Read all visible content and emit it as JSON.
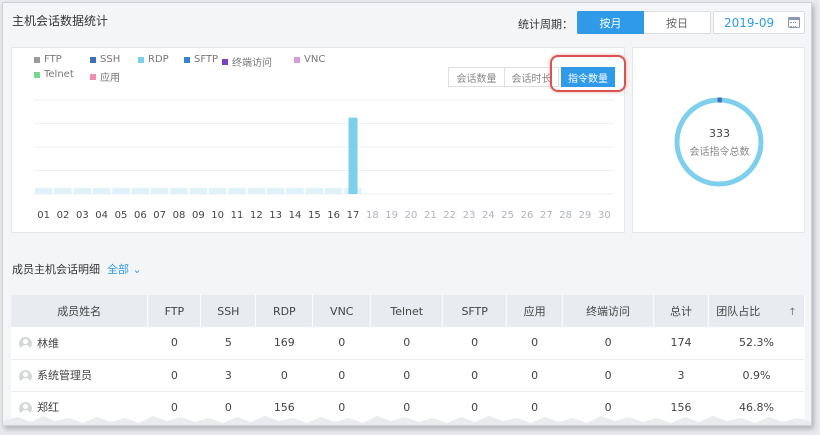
{
  "header": {
    "title": "主机会话数据统计",
    "period_label": "统计周期：",
    "by_month": "按月",
    "by_day": "按日",
    "date_value": "2019-09"
  },
  "legend": [
    {
      "label": "FTP",
      "color": "#9b9b9b"
    },
    {
      "label": "SSH",
      "color": "#3f6fb6"
    },
    {
      "label": "RDP",
      "color": "#7ecfee"
    },
    {
      "label": "SFTP",
      "color": "#3b82d6"
    },
    {
      "label": "终端访问",
      "color": "#7c3fc6"
    },
    {
      "label": "VNC",
      "color": "#d99be0"
    },
    {
      "label": "Telnet",
      "color": "#77d98a"
    },
    {
      "label": "应用",
      "color": "#f28db0"
    }
  ],
  "modes": {
    "count": "会话数量",
    "duration": "会话时长",
    "command": "指令数量"
  },
  "chart_data": {
    "type": "bar",
    "categories": [
      "01",
      "02",
      "03",
      "04",
      "05",
      "06",
      "07",
      "08",
      "09",
      "10",
      "11",
      "12",
      "13",
      "14",
      "15",
      "16",
      "17",
      "18",
      "19",
      "20",
      "21",
      "22",
      "23",
      "24",
      "25",
      "26",
      "27",
      "28",
      "29",
      "30"
    ],
    "series": [
      {
        "name": "RDP",
        "values": [
          0,
          0,
          0,
          0,
          0,
          0,
          0,
          0,
          0,
          0,
          0,
          0,
          0,
          0,
          0,
          0,
          325,
          0,
          0,
          0,
          0,
          0,
          0,
          0,
          0,
          0,
          0,
          0,
          0,
          0
        ]
      }
    ],
    "active_until_index": 16,
    "ylim": [
      0,
      400
    ],
    "grid": true,
    "legend_position": "top-left"
  },
  "ring": {
    "total": "333",
    "label": "会话指令总数",
    "main_color": "#7ecfee",
    "minor_color": "#3f6fb6",
    "minor_fraction": 0.009
  },
  "members": {
    "title": "成员主机会话明细",
    "filter": "全部 ⌄",
    "columns": [
      "成员姓名",
      "FTP",
      "SSH",
      "RDP",
      "VNC",
      "Telnet",
      "SFTP",
      "应用",
      "终端访问",
      "总计",
      "团队占比"
    ],
    "sort_indicator": "↑",
    "rows": [
      [
        "林维",
        "0",
        "5",
        "169",
        "0",
        "0",
        "0",
        "0",
        "0",
        "174",
        "52.3%"
      ],
      [
        "系统管理员",
        "0",
        "3",
        "0",
        "0",
        "0",
        "0",
        "0",
        "0",
        "3",
        "0.9%"
      ],
      [
        "郑红",
        "0",
        "0",
        "156",
        "0",
        "0",
        "0",
        "0",
        "0",
        "156",
        "46.8%"
      ]
    ]
  }
}
